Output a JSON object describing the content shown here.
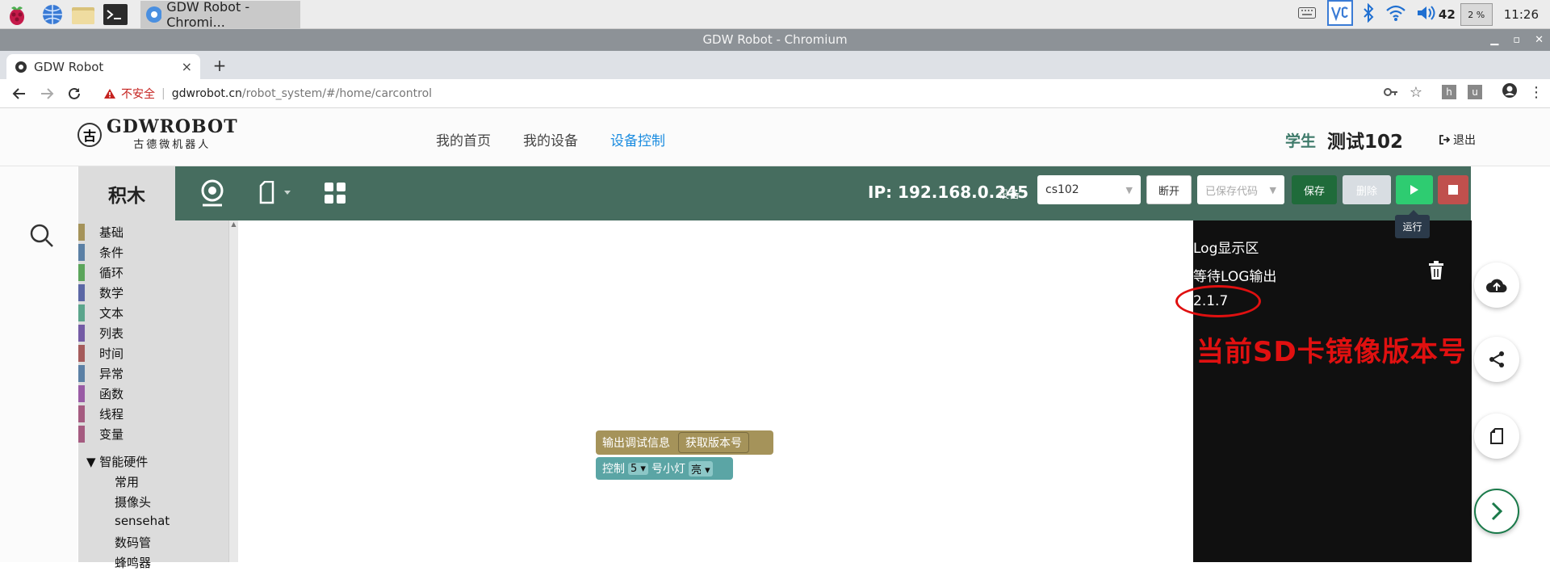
{
  "os": {
    "task_title": "GDW Robot - Chromi...",
    "volume": "42",
    "cpu": "2 %",
    "clock": "11:26"
  },
  "window": {
    "title": "GDW Robot - Chromium"
  },
  "browser": {
    "tab_title": "GDW Robot",
    "tab_close": "×",
    "new_tab": "+",
    "not_secure": "不安全",
    "url_host": "gdwrobot.cn",
    "url_path": "/robot_system/#/home/carcontrol"
  },
  "site": {
    "logo_text": "GDWROBOT",
    "logo_sub": "古德微机器人",
    "logo_mark": "古",
    "nav": [
      "我的首页",
      "我的设备",
      "设备控制"
    ],
    "role": "学生",
    "username": "测试102",
    "logout": "退出"
  },
  "toolbar": {
    "tab_blocks": "积木",
    "ip": "IP: 192.168.0.245",
    "device_label": "设备：",
    "device_value": "cs102",
    "disconnect": "断开",
    "saved_code_placeholder": "已保存代码",
    "save": "保存",
    "delete": "删除",
    "run_tooltip": "运行"
  },
  "categories": [
    {
      "label": "基础",
      "color": "#a5935a"
    },
    {
      "label": "条件",
      "color": "#5b80a5"
    },
    {
      "label": "循环",
      "color": "#5ba55b"
    },
    {
      "label": "数学",
      "color": "#5b67a5"
    },
    {
      "label": "文本",
      "color": "#5ba58c"
    },
    {
      "label": "列表",
      "color": "#745ba5"
    },
    {
      "label": "时间",
      "color": "#a55b5b"
    },
    {
      "label": "异常",
      "color": "#5b80a5"
    },
    {
      "label": "函数",
      "color": "#995ba5"
    },
    {
      "label": "线程",
      "color": "#a55b80"
    },
    {
      "label": "变量",
      "color": "#a55b80"
    }
  ],
  "hardware": {
    "group": "▼ 智能硬件",
    "items": [
      "常用",
      "摄像头",
      "sensehat",
      "数码管",
      "蜂鸣器"
    ]
  },
  "blocks": {
    "print": "输出调试信息",
    "get_version": "获取版本号",
    "control": "控制",
    "light_num": "5",
    "light_label": "号小灯",
    "light_state": "亮"
  },
  "log": {
    "title": "Log显示区",
    "waiting": "等待LOG输出",
    "version": "2.1.7",
    "annotation": "当前SD卡镜像版本号"
  }
}
